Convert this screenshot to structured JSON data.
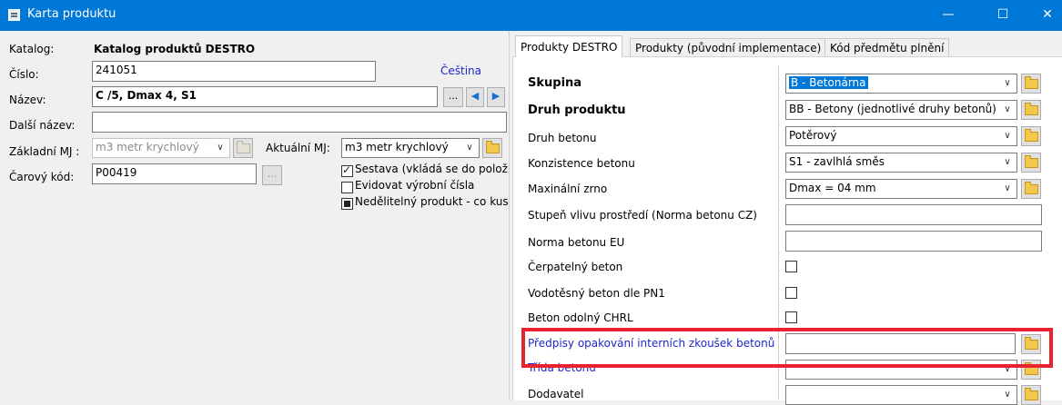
{
  "window": {
    "title": "Karta produktu",
    "minimize": "—",
    "maximize": "☐",
    "close": "✕"
  },
  "left": {
    "katalog_label": "Katalog:",
    "katalog_value": "Katalog produktů DESTRO",
    "cislo_label": "Číslo:",
    "cislo_value": "241051",
    "language_link": "Čeština",
    "nazev_label": "Název:",
    "nazev_value": "C /5, Dmax 4, S1",
    "nazev_more": "...",
    "prev_arrow": "◀",
    "next_arrow": "▶",
    "dalsi_label": "Další název:",
    "dalsi_value": "",
    "zakladni_label": "Základní MJ :",
    "zakladni_value": "m3 metr krychlový",
    "aktualni_label": "Aktuální MJ:",
    "aktualni_value": "m3 metr krychlový",
    "carovy_label": "Čarový kód:",
    "carovy_value": "P00419",
    "carovy_more": "...",
    "checkboxes": [
      {
        "label": "Sestava (vkládá se do polož",
        "state": "checked"
      },
      {
        "label": "Evidovat výrobní čísla",
        "state": "unchecked"
      },
      {
        "label": "Nedělitelný produkt - co kus",
        "state": "indeterminate"
      }
    ]
  },
  "tabs": [
    {
      "label": "Produkty DESTRO",
      "active": true
    },
    {
      "label": "Produkty (původní implementace)",
      "active": false
    },
    {
      "label": "Kód předmětu plnění",
      "active": false
    }
  ],
  "properties": {
    "skupina": {
      "label": "Skupina",
      "value": "B - Betonárna"
    },
    "druh_produktu": {
      "label": "Druh produktu",
      "value": "BB - Betony (jednotlivé druhy betonů)"
    },
    "druh_betonu": {
      "label": "Druh betonu",
      "value": "Potěrový"
    },
    "konzistence": {
      "label": "Konzistence betonu",
      "value": "S1 - zavlhlá směs"
    },
    "zrno": {
      "label": "Maxinální zrno",
      "value": "Dmax = 04 mm"
    },
    "stupen": {
      "label": "Stupeň vlivu prostředí (Norma betonu CZ)",
      "value": ""
    },
    "norma_eu": {
      "label": "Norma betonu EU",
      "value": ""
    },
    "cerpatelny": {
      "label": "Čerpatelný beton"
    },
    "vodotesny": {
      "label": "Vodotěsný beton dle PN1"
    },
    "chrl": {
      "label": "Beton odolný CHRL"
    },
    "predpisy": {
      "label": "Předpisy opakování interních zkoušek betonů",
      "value": ""
    },
    "trida": {
      "label": "Třída betonu",
      "value": ""
    },
    "dodavatel": {
      "label": "Dodavatel",
      "value": ""
    }
  },
  "colors": {
    "titlebar": "#0078d7",
    "highlight_box": "#e8222e",
    "link": "#1f26c8",
    "selection": "#0078d7"
  }
}
